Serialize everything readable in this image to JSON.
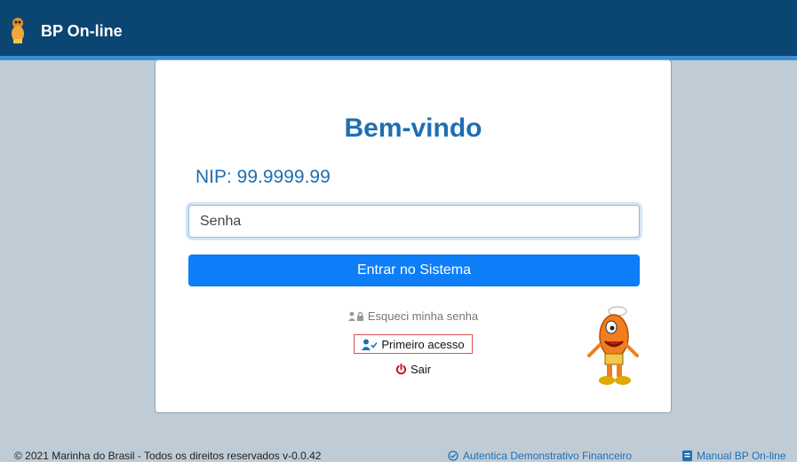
{
  "header": {
    "app_name": "BP On-line",
    "logo_icon": "mascot-logo-icon"
  },
  "login": {
    "title": "Bem-vindo",
    "nip": "NIP: 99.9999.99",
    "password_placeholder": "Senha",
    "submit_label": "Entrar no Sistema",
    "forgot_label": "Esqueci minha senha",
    "first_access_label": "Primeiro acesso",
    "exit_label": "Sair"
  },
  "footer": {
    "copyright": "© 2021 Marinha do Brasil - Todos os direitos reservados v-0.0.42",
    "authenticate_label": "Autentica Demonstrativo Financeiro",
    "manual_label": "Manual BP On-line"
  },
  "colors": {
    "header_bg": "#0b4572",
    "accent": "#0d7ef7",
    "title": "#1e6eb2",
    "highlight_border": "#d9534f",
    "exit_icon": "#d0021b"
  }
}
